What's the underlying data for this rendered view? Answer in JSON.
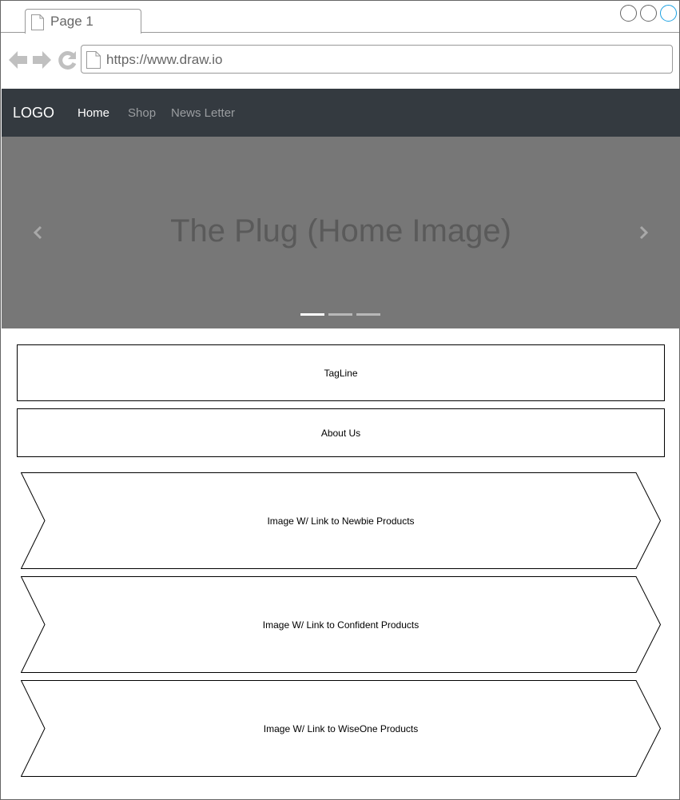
{
  "browser": {
    "tab_title": "Page 1",
    "url": "https://www.draw.io"
  },
  "navbar": {
    "logo": "LOGO",
    "links": [
      {
        "label": "Home",
        "active": true
      },
      {
        "label": "Shop",
        "active": false
      },
      {
        "label": "News Letter",
        "active": false
      }
    ]
  },
  "carousel": {
    "title": "The Plug (Home Image)",
    "slide_count": 3,
    "active_slide": 1
  },
  "sections": {
    "tagline": "TagLine",
    "about": "About Us"
  },
  "product_links": [
    {
      "label": "Image W/ Link to Newbie Products"
    },
    {
      "label": "Image W/ Link to Confident Products"
    },
    {
      "label": "Image W/ Link to WiseOne Products"
    }
  ],
  "colors": {
    "navbar_bg": "#343a40",
    "carousel_bg": "#777777",
    "window_btn_accent": "#1ba1e2"
  }
}
